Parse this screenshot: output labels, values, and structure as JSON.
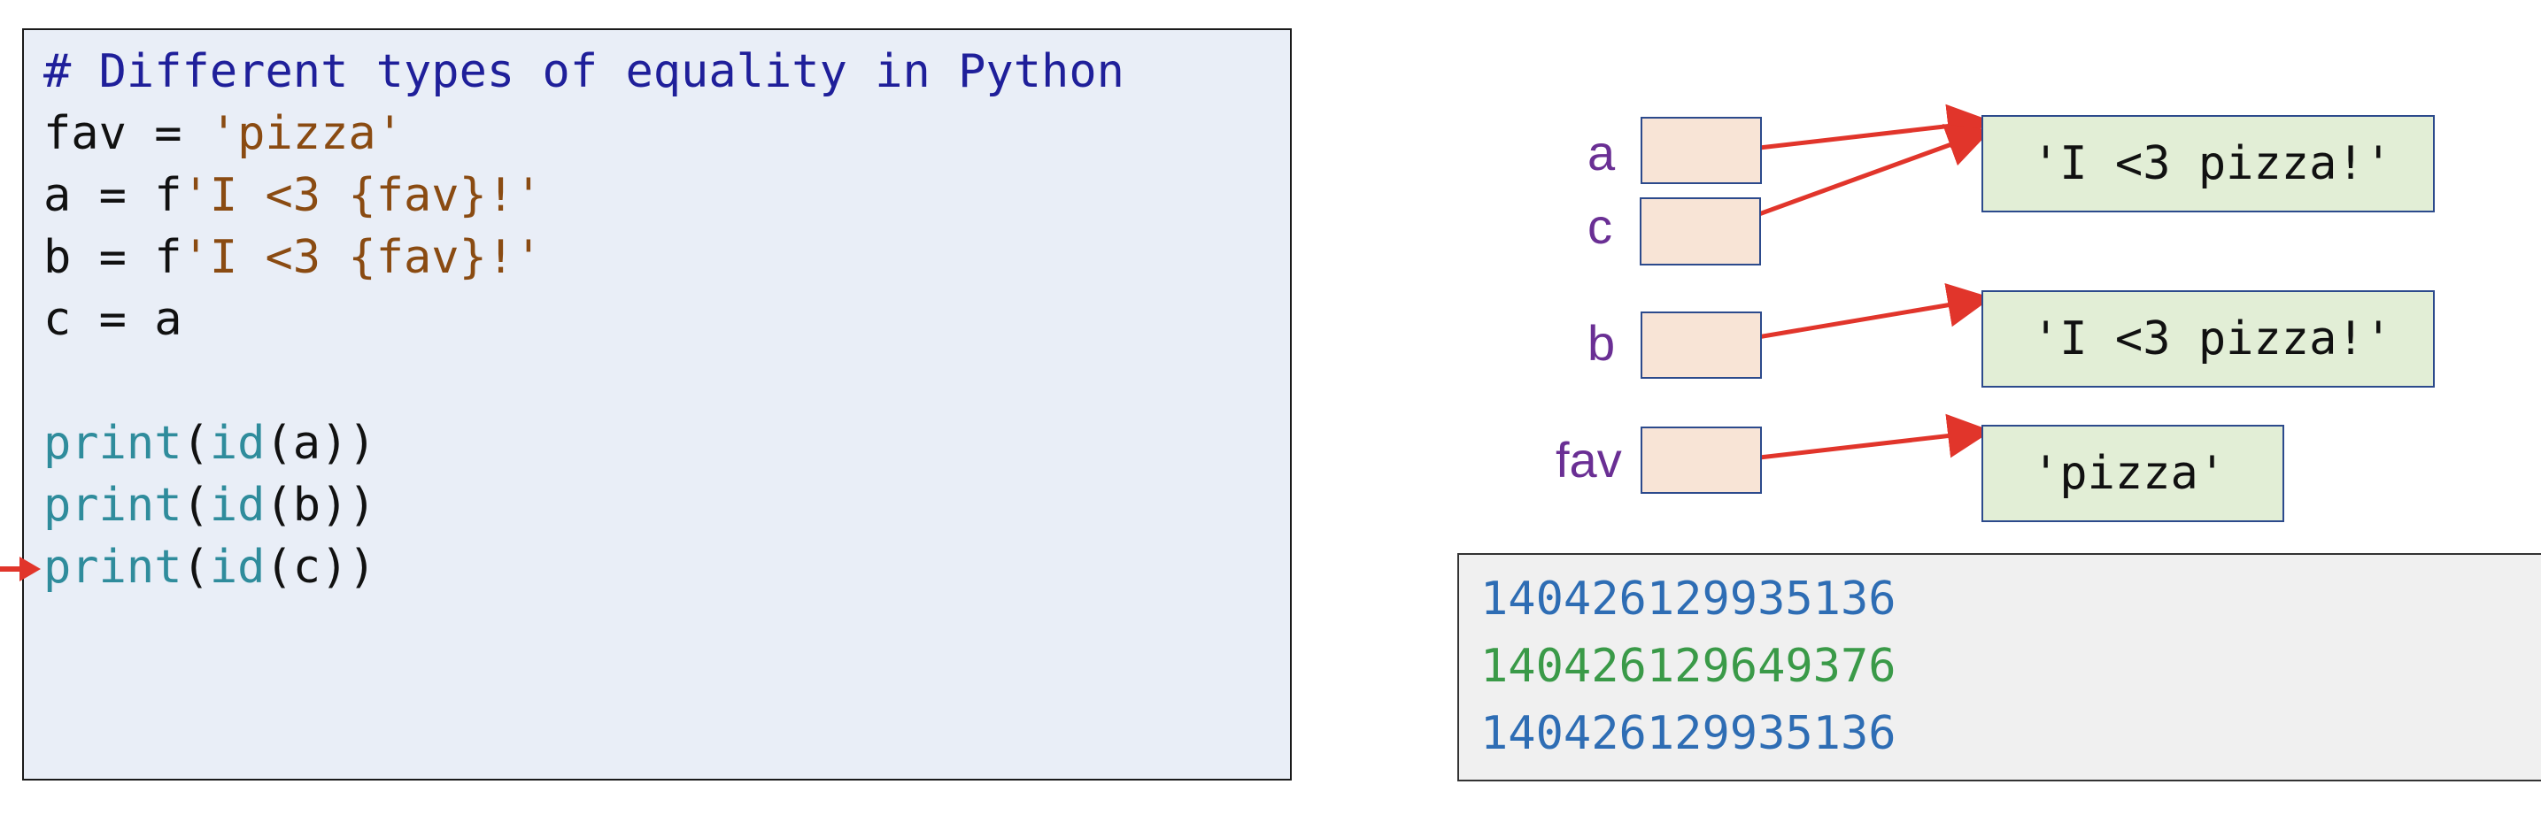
{
  "code": {
    "lines": [
      [
        {
          "t": "# Different types of equality in Python",
          "k": "comment"
        }
      ],
      [
        {
          "t": "fav = ",
          "k": "plain"
        },
        {
          "t": "'pizza'",
          "k": "str"
        }
      ],
      [
        {
          "t": "a = f",
          "k": "plain"
        },
        {
          "t": "'I <3 {fav}!'",
          "k": "str"
        }
      ],
      [
        {
          "t": "b = f",
          "k": "plain"
        },
        {
          "t": "'I <3 {fav}!'",
          "k": "str"
        }
      ],
      [
        {
          "t": "c = a",
          "k": "plain"
        }
      ],
      [],
      [
        {
          "t": "print",
          "k": "fn"
        },
        {
          "t": "(",
          "k": "plain"
        },
        {
          "t": "id",
          "k": "fn"
        },
        {
          "t": "(a))",
          "k": "plain"
        }
      ],
      [
        {
          "t": "print",
          "k": "fn"
        },
        {
          "t": "(",
          "k": "plain"
        },
        {
          "t": "id",
          "k": "fn"
        },
        {
          "t": "(b))",
          "k": "plain"
        }
      ],
      [
        {
          "t": "print",
          "k": "fn"
        },
        {
          "t": "(",
          "k": "plain"
        },
        {
          "t": "id",
          "k": "fn"
        },
        {
          "t": "(c))",
          "k": "plain"
        }
      ]
    ],
    "current_line": 9
  },
  "diagram": {
    "variables": [
      {
        "name": "a",
        "target": "obj1"
      },
      {
        "name": "c",
        "target": "obj1"
      },
      {
        "name": "b",
        "target": "obj2"
      },
      {
        "name": "fav",
        "target": "obj3"
      }
    ],
    "objects": [
      {
        "id": "obj1",
        "value": "'I <3 pizza!'"
      },
      {
        "id": "obj2",
        "value": "'I <3 pizza!'"
      },
      {
        "id": "obj3",
        "value": "'pizza'"
      }
    ]
  },
  "output": {
    "lines": [
      {
        "text": "140426129935136",
        "color": "#2e6db4"
      },
      {
        "text": "140426129649376",
        "color": "#3a9a48"
      },
      {
        "text": "140426129935136",
        "color": "#2e6db4"
      }
    ]
  },
  "colors": {
    "arrow": "#e1352b",
    "code_bg": "#e9eef7",
    "var_box": "#f8e4d6",
    "obj_box": "#e2eed6",
    "var_label": "#6a2f94"
  }
}
